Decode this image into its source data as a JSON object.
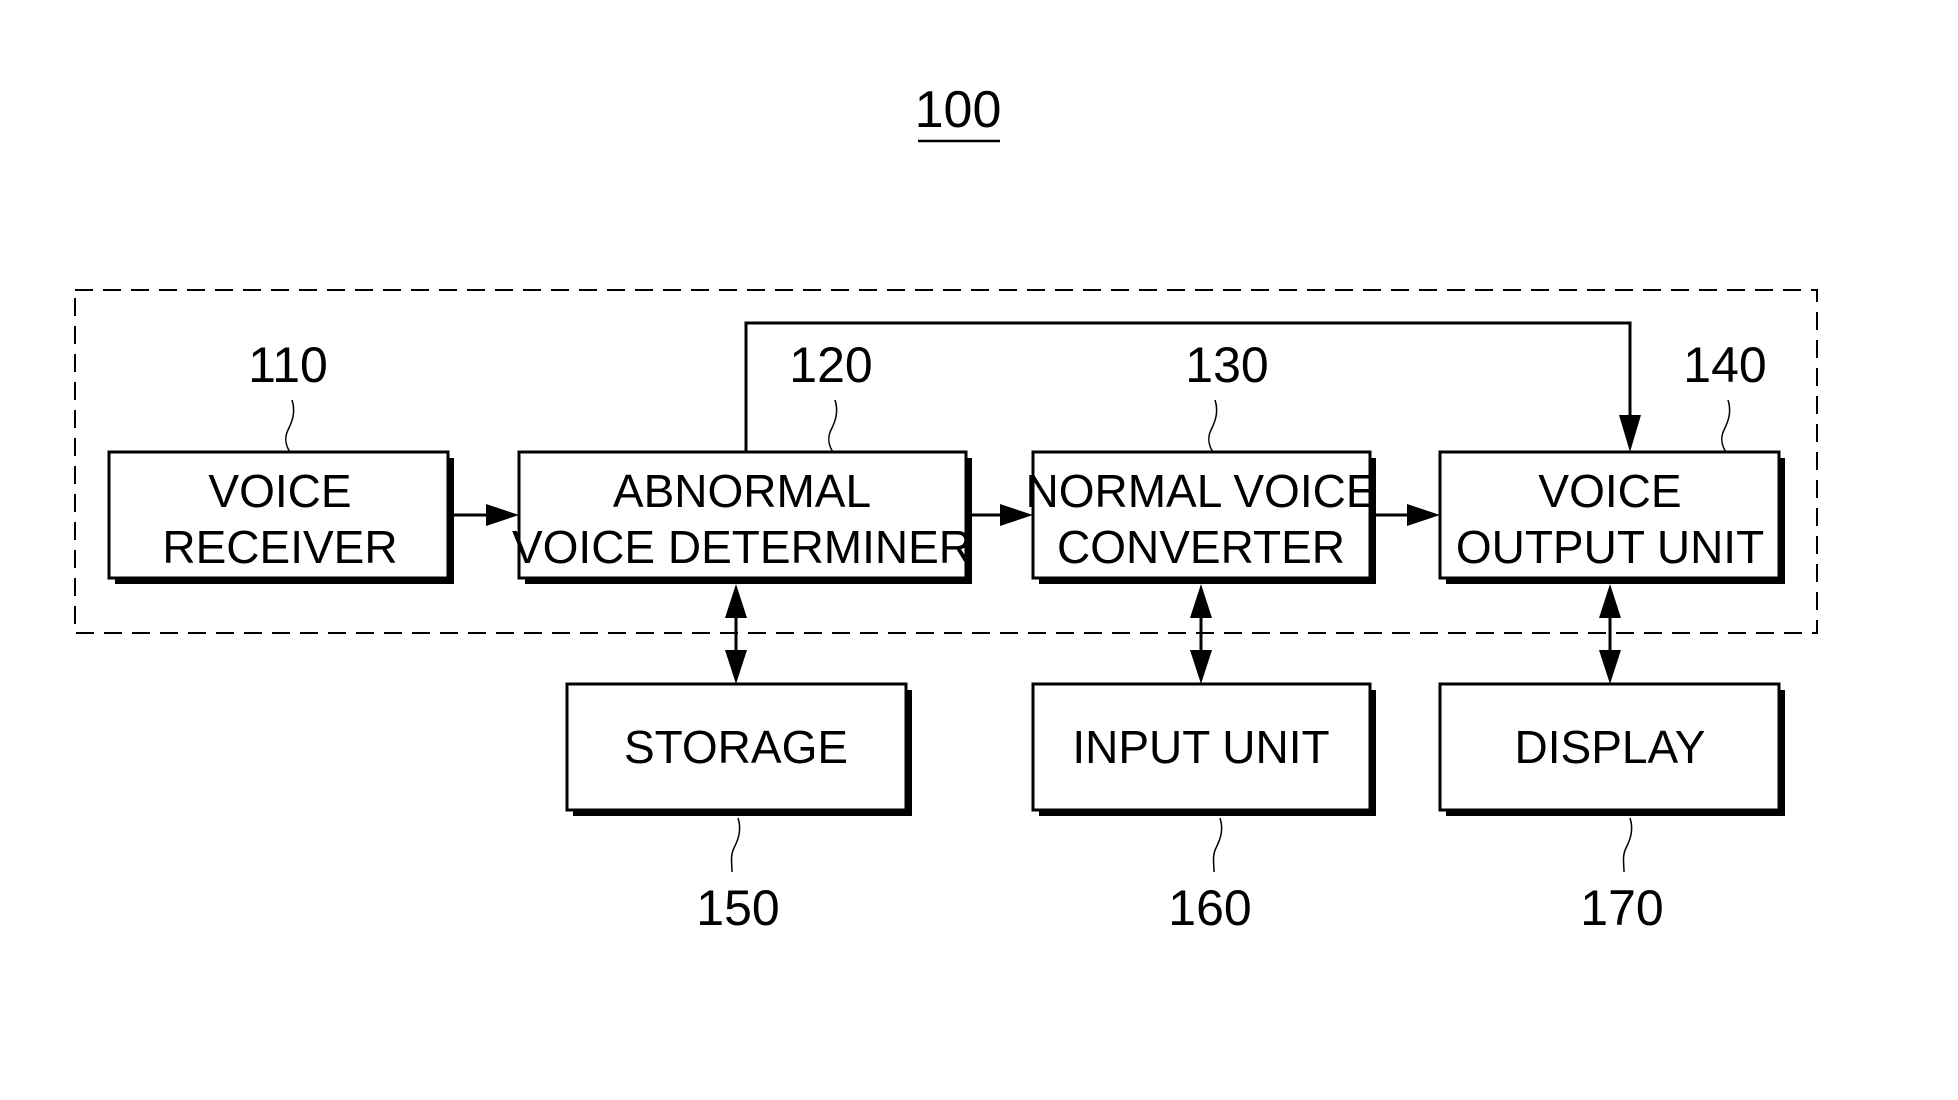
{
  "diagram": {
    "title_ref": "100",
    "boxes": [
      {
        "id": "voice-receiver",
        "ref": "110",
        "lines": [
          "VOICE",
          "RECEIVER"
        ]
      },
      {
        "id": "abnormal-voice-determiner",
        "ref": "120",
        "lines": [
          "ABNORMAL",
          "VOICE DETERMINER"
        ]
      },
      {
        "id": "normal-voice-converter",
        "ref": "130",
        "lines": [
          "NORMAL VOICE",
          "CONVERTER"
        ]
      },
      {
        "id": "voice-output-unit",
        "ref": "140",
        "lines": [
          "VOICE",
          "OUTPUT UNIT"
        ]
      },
      {
        "id": "storage",
        "ref": "150",
        "lines": [
          "STORAGE"
        ]
      },
      {
        "id": "input-unit",
        "ref": "160",
        "lines": [
          "INPUT UNIT"
        ]
      },
      {
        "id": "display",
        "ref": "170",
        "lines": [
          "DISPLAY"
        ]
      }
    ],
    "connections": [
      {
        "from": "voice-receiver",
        "to": "abnormal-voice-determiner",
        "type": "one-way"
      },
      {
        "from": "abnormal-voice-determiner",
        "to": "normal-voice-converter",
        "type": "one-way"
      },
      {
        "from": "normal-voice-converter",
        "to": "voice-output-unit",
        "type": "one-way"
      },
      {
        "from": "abnormal-voice-determiner",
        "to": "voice-output-unit",
        "type": "one-way",
        "route": "over-top"
      },
      {
        "from": "abnormal-voice-determiner",
        "to": "storage",
        "type": "two-way"
      },
      {
        "from": "normal-voice-converter",
        "to": "input-unit",
        "type": "two-way"
      },
      {
        "from": "voice-output-unit",
        "to": "display",
        "type": "two-way"
      }
    ],
    "group_border": "dashed"
  }
}
